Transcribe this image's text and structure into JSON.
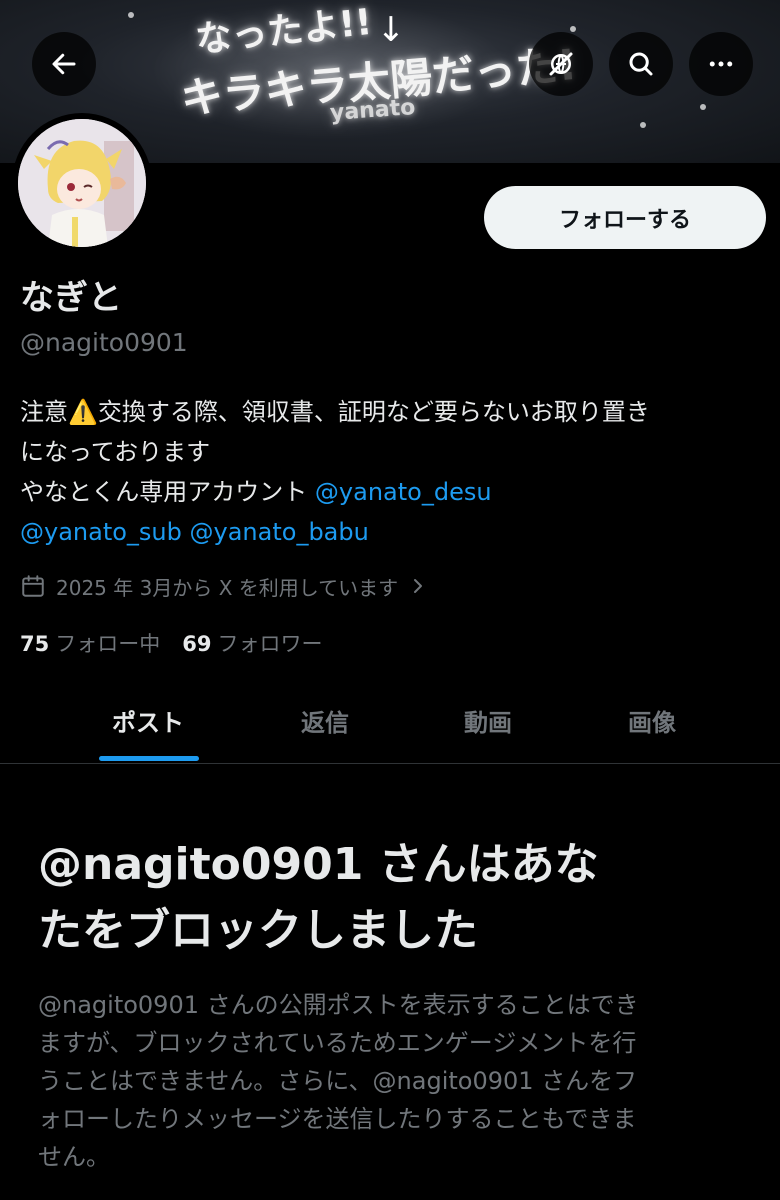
{
  "banner": {
    "line1": "なったよ!!",
    "line2": "キラキラ太陽だった!",
    "line3": "yanato"
  },
  "nav": {
    "back_icon": "arrow-left-icon",
    "translate_icon": "translate-off-icon",
    "search_icon": "search-icon",
    "more_icon": "more-icon"
  },
  "profile": {
    "display_name": "なぎと",
    "handle": "@nagito0901",
    "follow_label": "フォローする",
    "bio": {
      "line1": "注意⚠️交換する際、領収書、証明など要らないお取り置き",
      "line2": "になっております",
      "line3_text": "やなとくん専用アカウント ",
      "line3_mention": "@yanato_desu",
      "line4_mention1": "@yanato_sub",
      "line4_mention2": "@yanato_babu"
    },
    "joined": "2025 年 3月から X を利用しています",
    "following_count": "75",
    "following_label": "フォロー中",
    "followers_count": "69",
    "followers_label": "フォロワー"
  },
  "tabs": [
    {
      "label": "ポスト",
      "active": true
    },
    {
      "label": "返信",
      "active": false
    },
    {
      "label": "動画",
      "active": false
    },
    {
      "label": "画像",
      "active": false
    }
  ],
  "blocked": {
    "title_line1": "@nagito0901 さんはあな",
    "title_line2": "たをブロックしました",
    "desc_line1": "@nagito0901 さんの公開ポストを表示することはでき",
    "desc_line2": "ますが、ブロックされているためエンゲージメントを行",
    "desc_line3": "うことはできません。さらに、@nagito0901 さんをフ",
    "desc_line4": "ォローしたりメッセージを送信したりすることもできま",
    "desc_line5": "せん。"
  },
  "colors": {
    "background": "#000000",
    "text_primary": "#e7e9ea",
    "text_secondary": "#71767b",
    "accent": "#1d9bf0",
    "follow_button_bg": "#eff3f4"
  }
}
